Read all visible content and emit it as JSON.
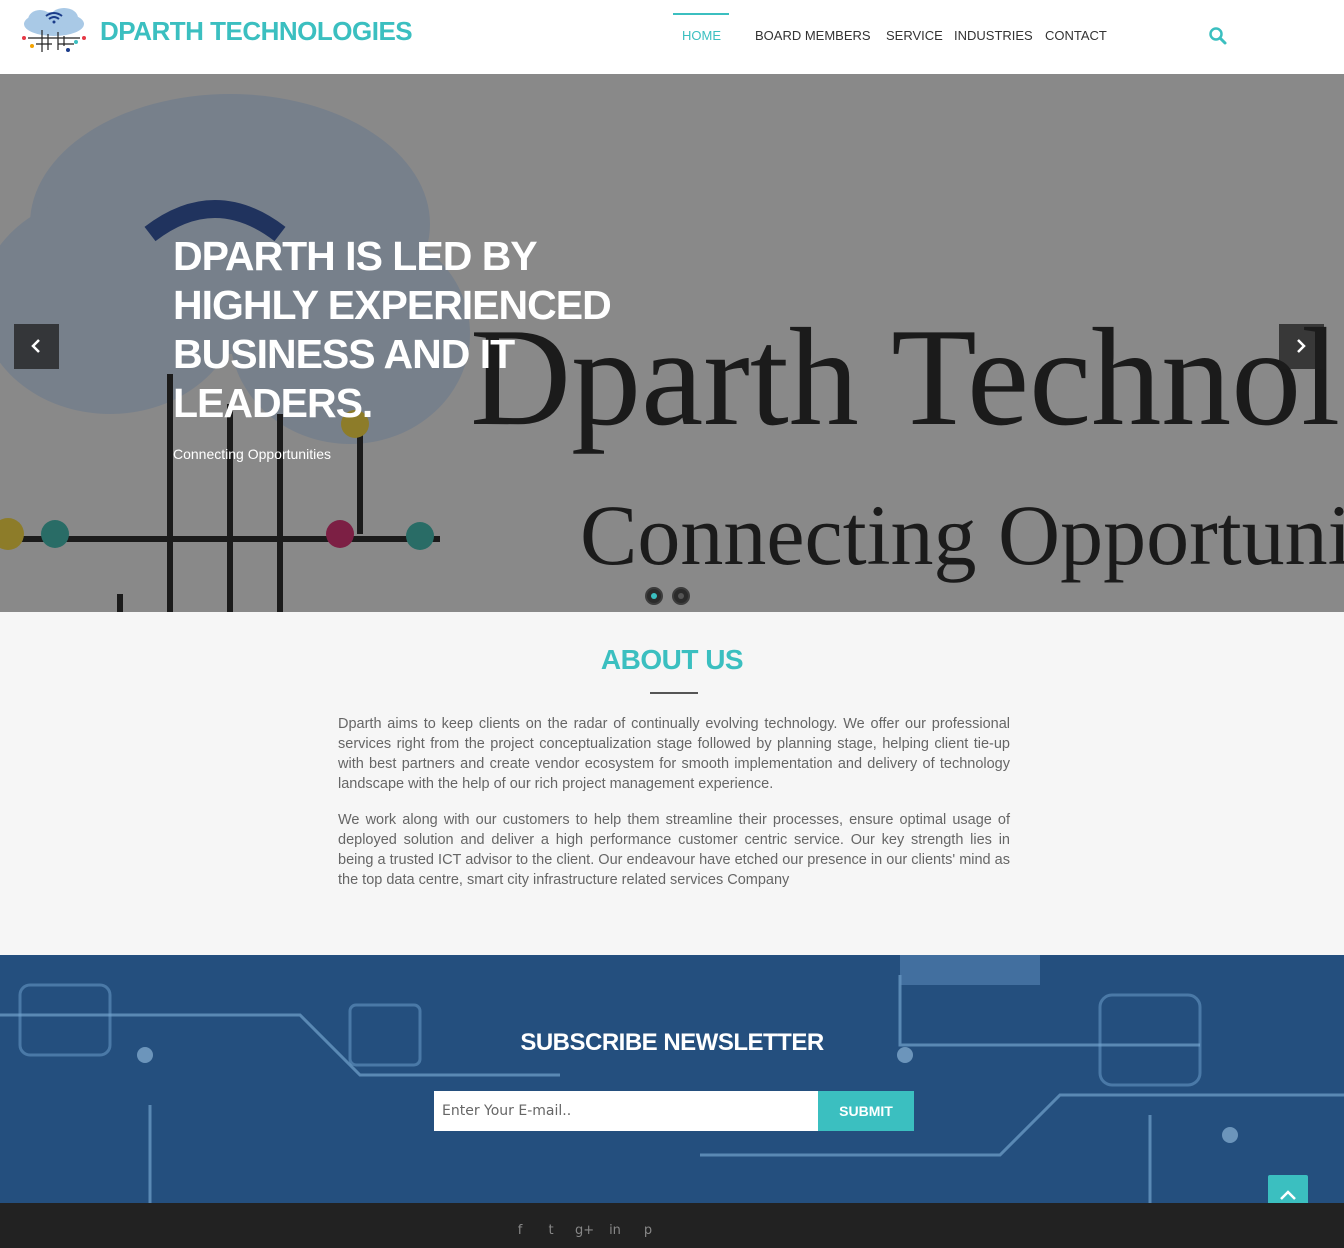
{
  "header": {
    "brand": "DPARTH TECHNOLOGIES",
    "nav": {
      "home": "HOME",
      "board": "BOARD MEMBERS",
      "service": "SERVICE",
      "industries": "INDUSTRIES",
      "contact": "CONTACT"
    },
    "search_icon": "search-icon",
    "accent_color": "#3bbfc0"
  },
  "hero": {
    "title": "DPARTH IS LED BY HIGHLY EXPERIENCED BUSINESS AND IT LEADERS.",
    "subtitle": "Connecting Opportunities",
    "bg_text_line1": "Dparth Technologies",
    "bg_text_line2": "Connecting Opportunities",
    "slide_count": 2,
    "active_slide": 1
  },
  "about": {
    "title": "ABOUT US",
    "p1": "Dparth aims to keep clients on the radar of continually evolving technology. We offer our professional services right from the project conceptualization stage followed by planning stage, helping client tie-up with best partners and create vendor ecosystem for smooth implementation and delivery of technology landscape with the help of our rich project management experience.",
    "p2": "We work along with our customers to help them streamline their processes, ensure optimal usage of deployed solution and deliver a high performance customer centric service. Our key strength lies in being a trusted ICT advisor to the client. Our endeavour have etched our presence in our clients' mind as the top data centre, smart city infrastructure related services Company"
  },
  "newsletter": {
    "title": "SUBSCRIBE NEWSLETTER",
    "placeholder": "Enter Your E-mail..",
    "submit": "SUBMIT"
  },
  "footer": {
    "social": {
      "facebook": "f",
      "twitter": "t",
      "googleplus": "g+",
      "linkedin": "in",
      "pinterest": "p"
    }
  }
}
